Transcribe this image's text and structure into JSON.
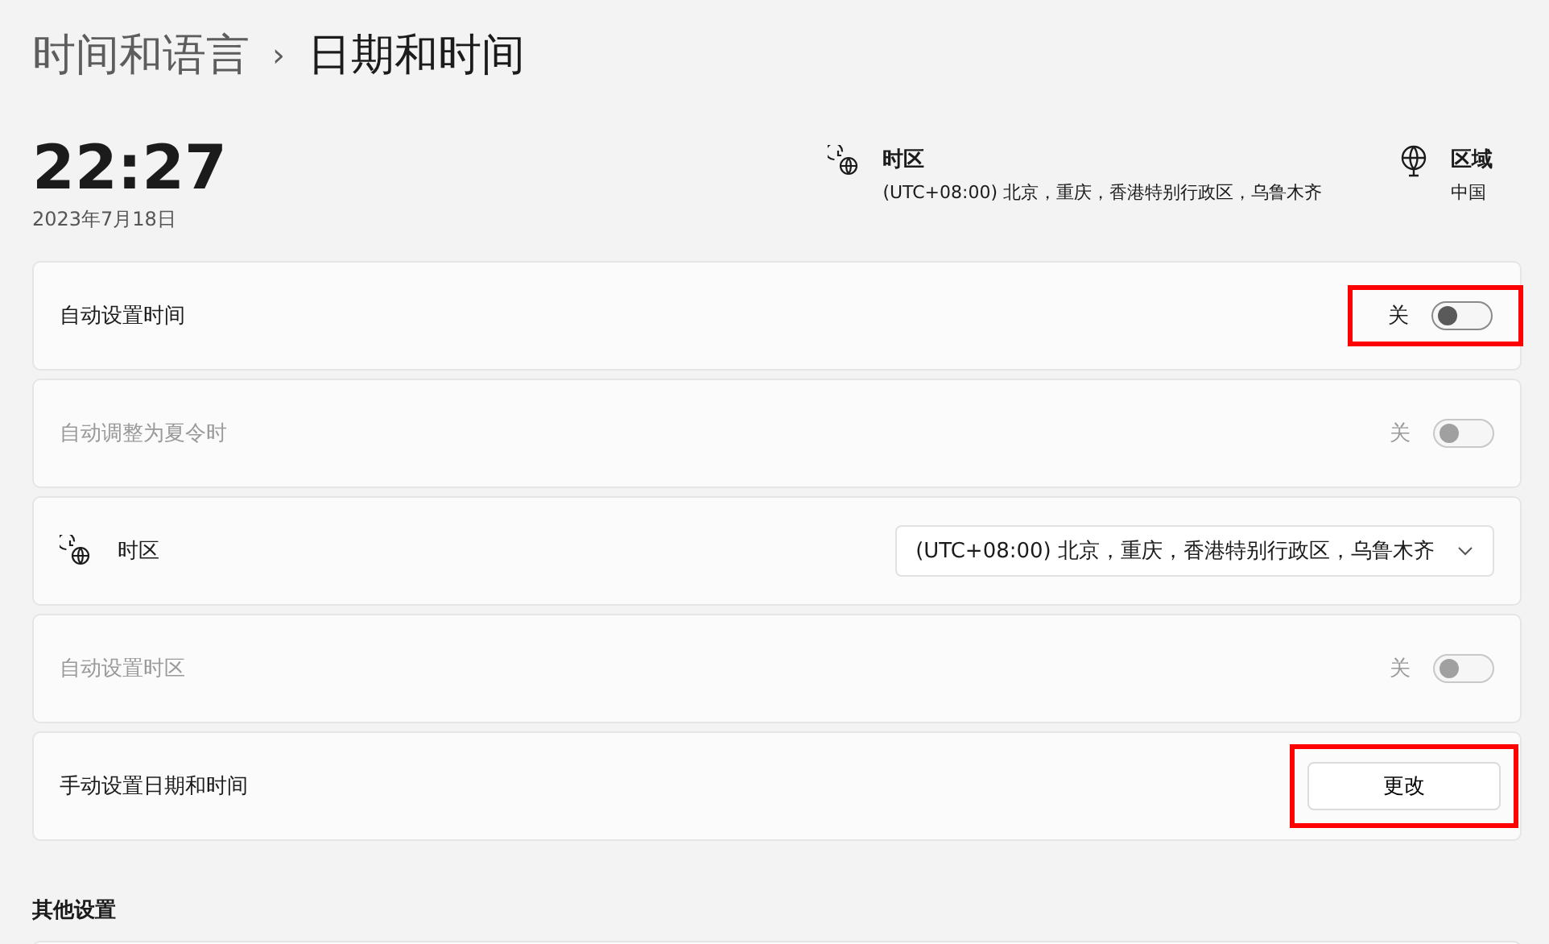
{
  "breadcrumb": {
    "parent": "时间和语言",
    "separator": "›",
    "current": "日期和时间"
  },
  "clock": {
    "time": "22:27",
    "date": "2023年7月18日"
  },
  "summary": [
    {
      "kind": "timezone",
      "title": "时区",
      "value": "(UTC+08:00) 北京，重庆，香港特别行政区，乌鲁木齐"
    },
    {
      "kind": "region",
      "title": "区域",
      "value": "中国"
    }
  ],
  "settings": [
    {
      "kind": "toggle",
      "label": "自动设置时间",
      "state_label": "关",
      "on": false,
      "disabled": false,
      "highlighted": true
    },
    {
      "kind": "toggle",
      "label": "自动调整为夏令时",
      "state_label": "关",
      "on": false,
      "disabled": true,
      "highlighted": false
    },
    {
      "kind": "dropdown",
      "label": "时区",
      "value": "(UTC+08:00) 北京，重庆，香港特别行政区，乌鲁木齐",
      "highlighted": false
    },
    {
      "kind": "toggle",
      "label": "自动设置时区",
      "state_label": "关",
      "on": false,
      "disabled": true,
      "highlighted": false
    },
    {
      "kind": "button",
      "label": "手动设置日期和时间",
      "button": "更改",
      "highlighted": true
    }
  ],
  "other_section": {
    "title": "其他设置"
  }
}
